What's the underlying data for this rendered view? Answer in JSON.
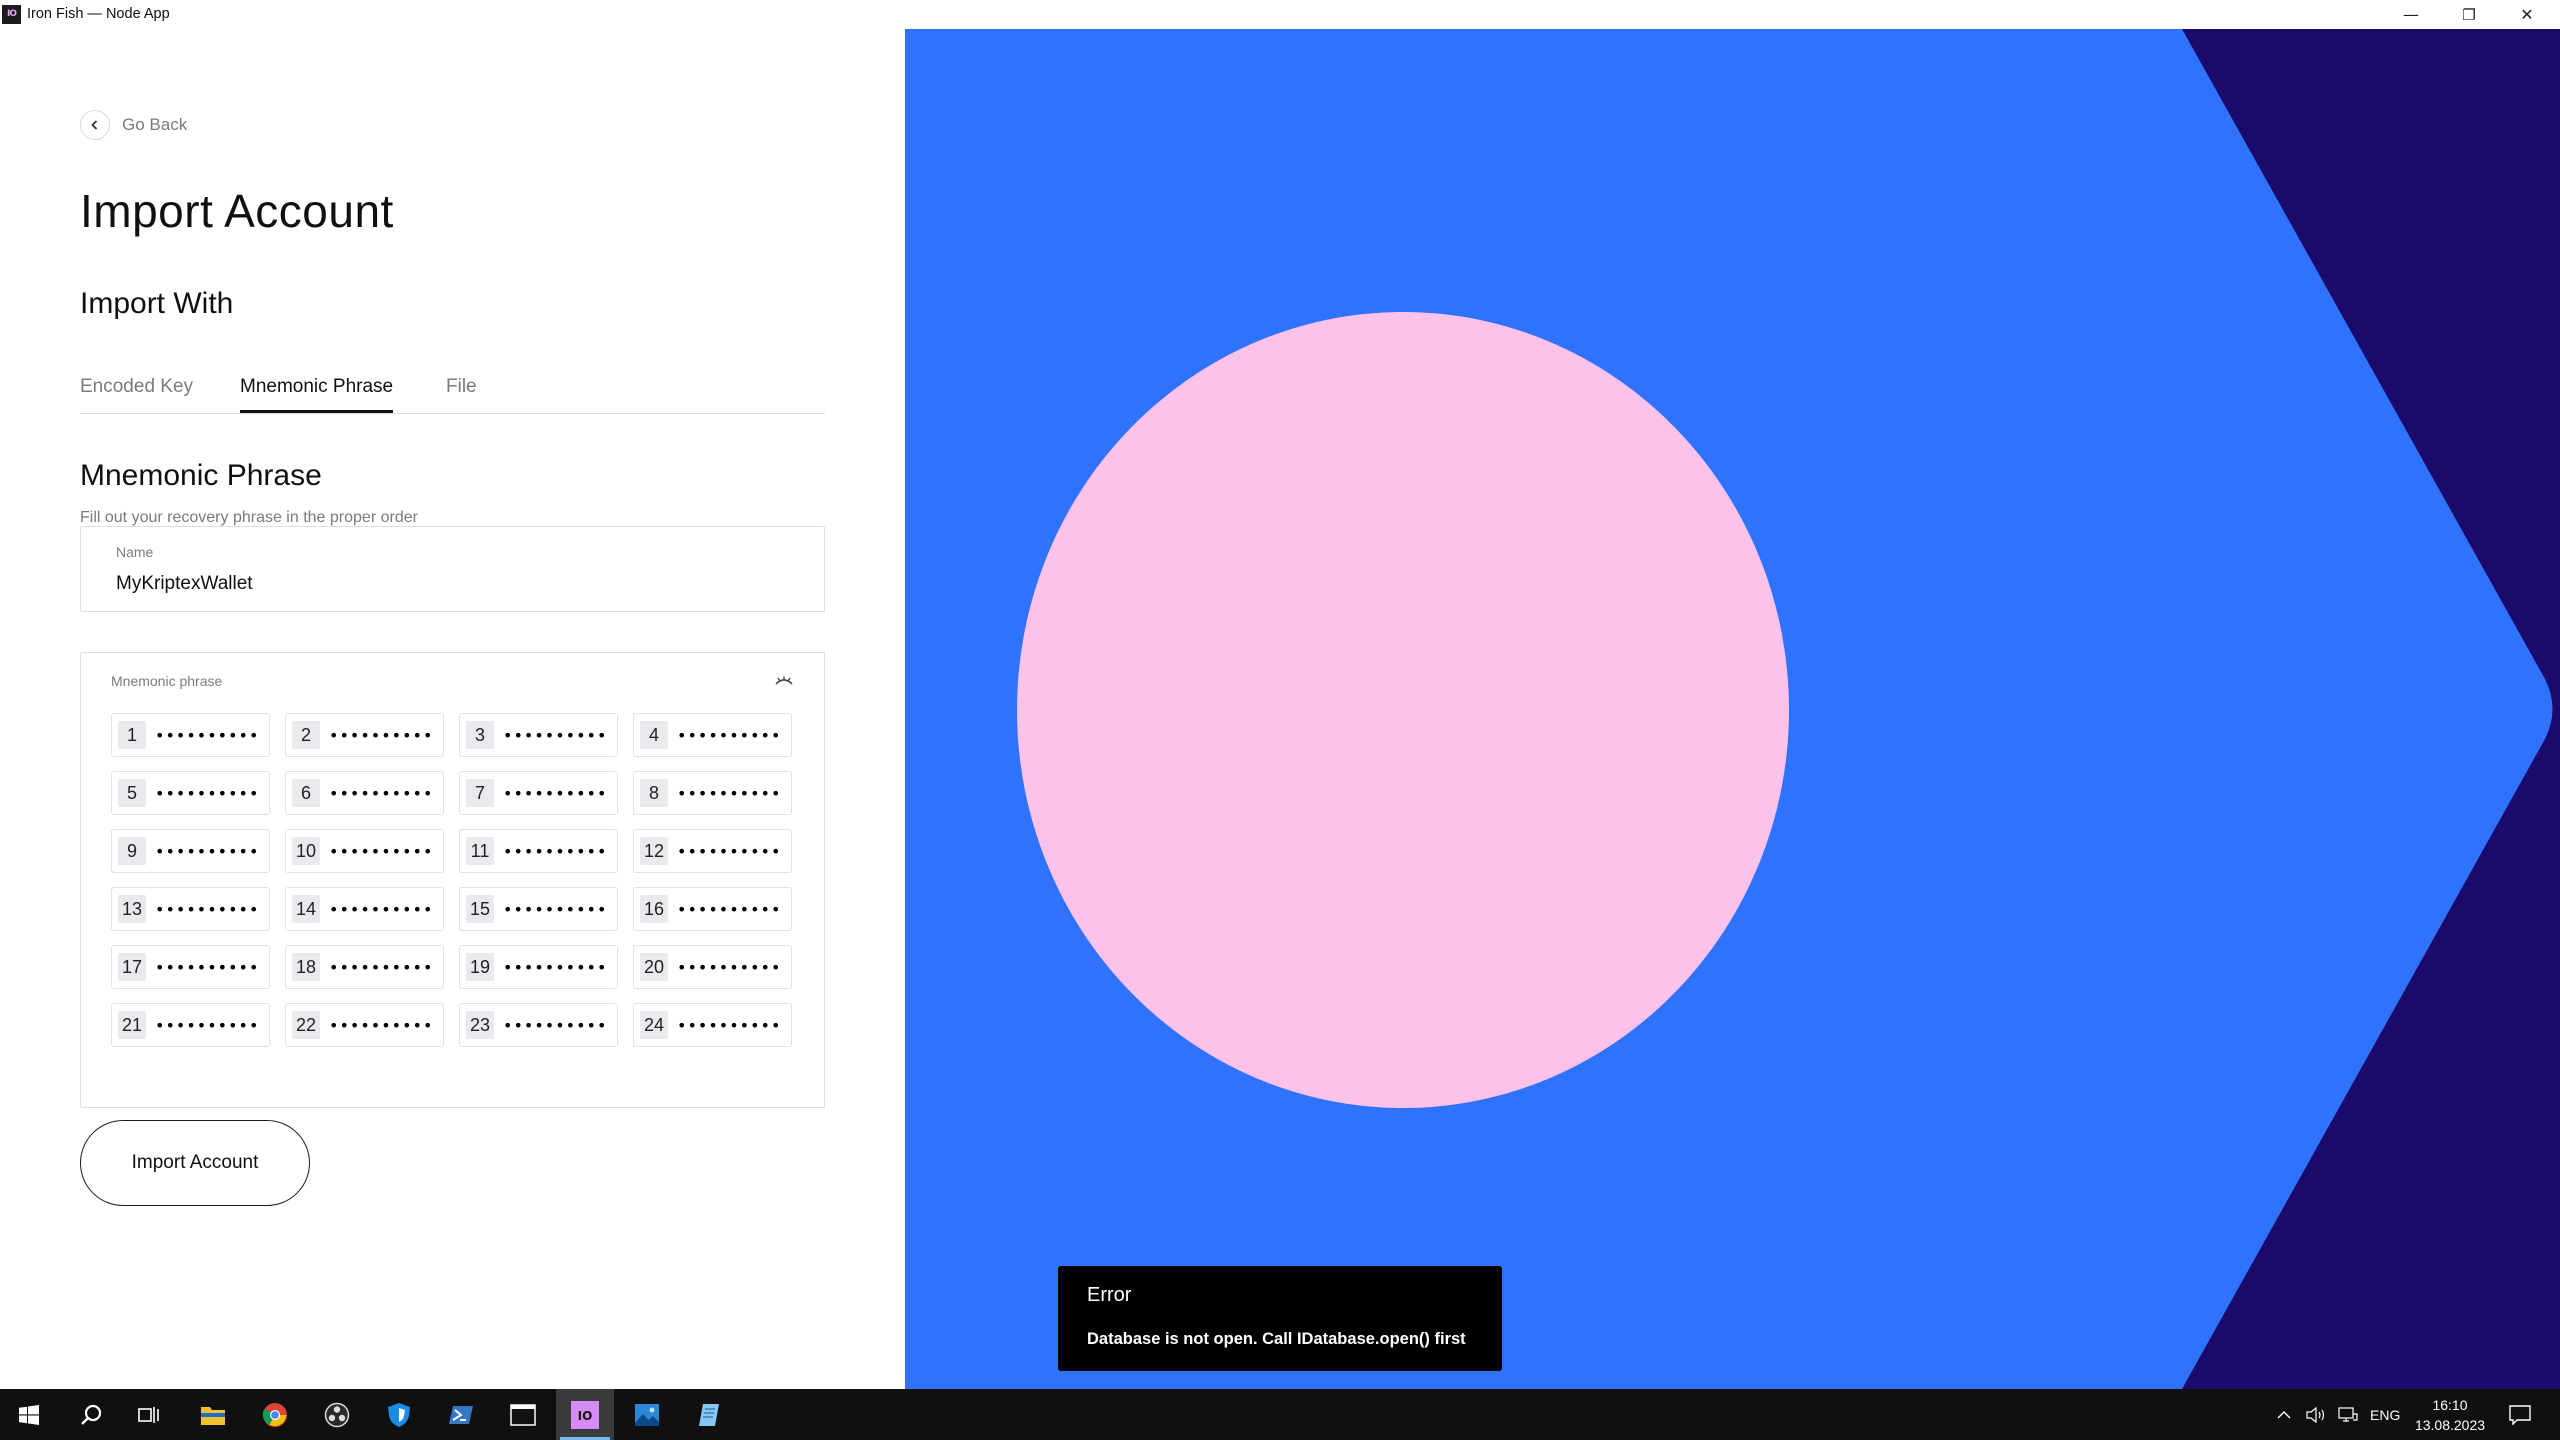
{
  "window": {
    "title": "Iron Fish — Node App",
    "app_icon_text": "IO",
    "controls": {
      "minimize": "—",
      "restore": "❐",
      "close": "✕"
    }
  },
  "left": {
    "go_back": "Go Back",
    "page_title": "Import Account",
    "import_with": "Import With",
    "tabs": [
      {
        "label": "Encoded Key",
        "active": false
      },
      {
        "label": "Mnemonic Phrase",
        "active": true
      },
      {
        "label": "File",
        "active": false
      }
    ],
    "section_title": "Mnemonic Phrase",
    "section_subtitle": "Fill out your recovery phrase in the proper order",
    "name_field": {
      "label": "Name",
      "value": "MyKriptexWallet"
    },
    "mnemonic": {
      "label": "Mnemonic phrase",
      "mask": "••••••••••",
      "words": [
        "1",
        "2",
        "3",
        "4",
        "5",
        "6",
        "7",
        "8",
        "9",
        "10",
        "11",
        "12",
        "13",
        "14",
        "15",
        "16",
        "17",
        "18",
        "19",
        "20",
        "21",
        "22",
        "23",
        "24"
      ]
    },
    "import_button": "Import Account"
  },
  "art": {
    "colors": {
      "blue": "#2f73fd",
      "navy": "#1a0a6b",
      "pink": "#fdc2ea"
    }
  },
  "toast": {
    "title": "Error",
    "message": "Database is not open. Call IDatabase.open() first"
  },
  "taskbar": {
    "apps": [
      "start-icon",
      "search-icon",
      "task-view-icon",
      "file-explorer-icon",
      "chrome-icon",
      "obs-icon",
      "shield-app-icon",
      "powershell-icon",
      "terminal-icon",
      "ironfish-app-icon",
      "photos-icon",
      "notepad-icon"
    ],
    "tray": {
      "language": "ENG",
      "time": "16:10",
      "date": "13.08.2023"
    }
  }
}
